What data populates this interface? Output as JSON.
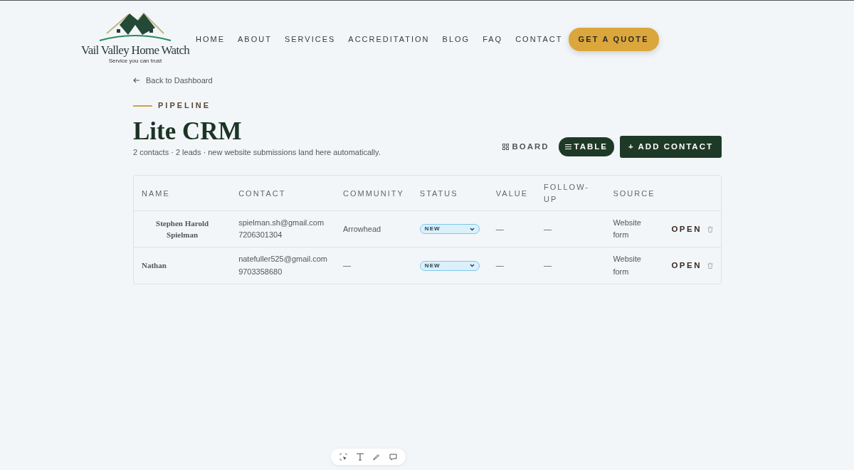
{
  "brand": {
    "name": "Vail Valley Home Watch",
    "tagline": "Service you can trust"
  },
  "nav": {
    "items": [
      "HOME",
      "ABOUT",
      "SERVICES",
      "ACCREDITATION",
      "BLOG",
      "FAQ",
      "CONTACT"
    ],
    "cta": "GET A QUOTE"
  },
  "back_link": "Back to Dashboard",
  "eyebrow": "PIPELINE",
  "title": "Lite CRM",
  "summary": "2 contacts · 2 leads · new website submissions land here automatically.",
  "views": [
    {
      "label": "BOARD",
      "kind": "board",
      "selected": false
    },
    {
      "label": "TABLE",
      "kind": "table",
      "selected": true
    }
  ],
  "add_button": "+ ADD CONTACT",
  "table": {
    "columns": [
      "NAME",
      "CONTACT",
      "COMMUNITY",
      "STATUS",
      "VALUE",
      "FOLLOW-UP",
      "SOURCE"
    ],
    "rows": [
      {
        "name": "Stephen Harold Spielman",
        "email": "spielman.sh@gmail.com",
        "phone": "7206301304",
        "community": "Arrowhead",
        "status": "NEW",
        "value": "—",
        "follow_up": "—",
        "source": "Website form",
        "action": "OPEN"
      },
      {
        "name": "Nathan",
        "email": "natefuller525@gmail.com",
        "phone": "9703358680",
        "community": "—",
        "status": "NEW",
        "value": "—",
        "follow_up": "—",
        "source": "Website form",
        "action": "OPEN"
      }
    ]
  }
}
